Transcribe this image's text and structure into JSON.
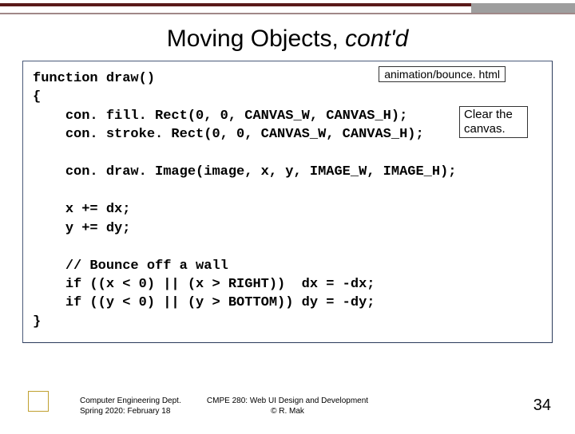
{
  "title_plain": "Moving Objects, ",
  "title_em": "cont'd",
  "file_label": "animation/bounce. html",
  "annotation": "Clear the canvas.",
  "code": "function draw()\n{\n    con. fill. Rect(0, 0, CANVAS_W, CANVAS_H);\n    con. stroke. Rect(0, 0, CANVAS_W, CANVAS_H);\n\n    con. draw. Image(image, x, y, IMAGE_W, IMAGE_H);\n\n    x += dx;\n    y += dy;\n\n    // Bounce off a wall\n    if ((x < 0) || (x > RIGHT))  dx = -dx;\n    if ((y < 0) || (y > BOTTOM)) dy = -dy;\n}",
  "footer_left_line1": "Computer Engineering Dept.",
  "footer_left_line2": "Spring 2020: February 18",
  "footer_mid_line1": "CMPE 280: Web UI Design and Development",
  "footer_mid_line2": "© R. Mak",
  "page_number": "34"
}
